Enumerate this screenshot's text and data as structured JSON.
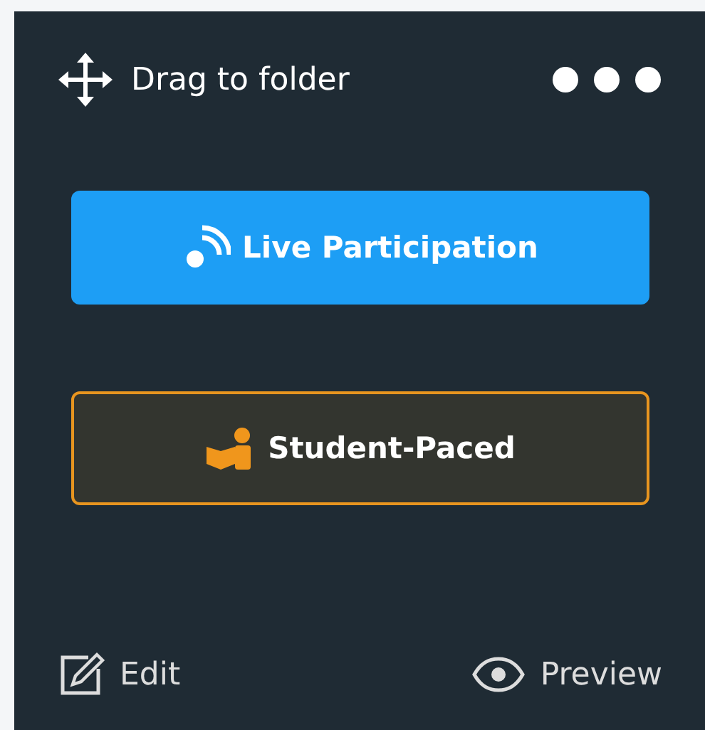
{
  "header": {
    "drag_label": "Drag to folder"
  },
  "modes": [
    {
      "kind": "live",
      "label": "Live Participation"
    },
    {
      "kind": "student",
      "label": "Student-Paced"
    }
  ],
  "footer": [
    {
      "kind": "edit",
      "label": "Edit"
    },
    {
      "kind": "preview",
      "label": "Preview"
    }
  ]
}
